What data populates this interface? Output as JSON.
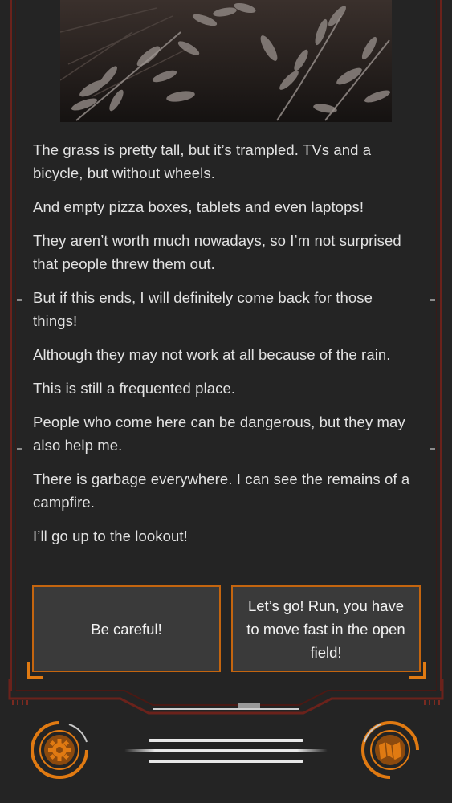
{
  "story": {
    "paragraphs": [
      "The grass is pretty tall, but it’s trampled. TVs and a bicycle, but without wheels.",
      "And empty pizza boxes, tablets and even laptops!",
      "They aren’t worth much nowadays, so I’m not surprised that people threw them out.",
      "But if this ends, I will definitely come back for those things!",
      "Although they may not work at all because of the rain.",
      "This is still a frequented place.",
      "People who come here can be dangerous, but they may also help me.",
      "There is garbage everywhere. I can see the remains of a campfire.",
      "I’ll go up to the lookout!"
    ]
  },
  "choices": [
    {
      "label": "Be careful!"
    },
    {
      "label": "Let’s go! Run, you have to move fast in the open field!"
    }
  ],
  "icons": {
    "left": "settings-gear-icon",
    "right": "map-icon"
  },
  "colors": {
    "accent": "#e07a12",
    "frame": "#6b221b",
    "background": "#242424",
    "choice_bg": "#3a3a3a",
    "text": "#e2e2e2"
  }
}
